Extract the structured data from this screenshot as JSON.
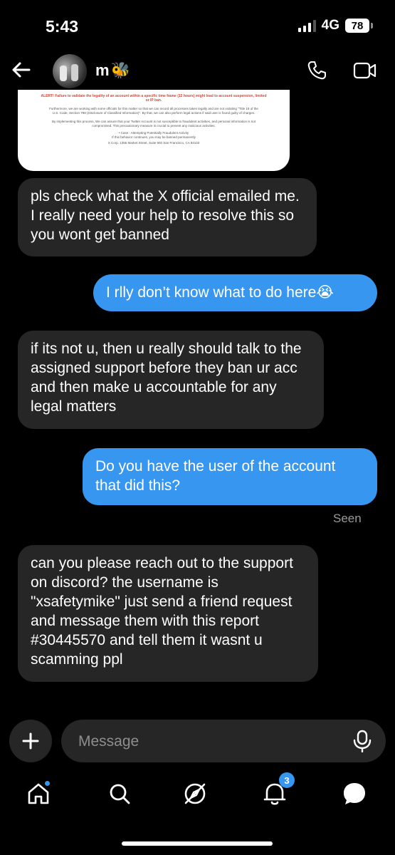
{
  "status_bar": {
    "time": "5:43",
    "network": "4G",
    "battery": "78"
  },
  "header": {
    "contact_name": "m",
    "contact_emoji": "🐝"
  },
  "attachment": {
    "alert_text": "ALERT! Failure to validate the legality of an account within a specific time frame (12 hours) might lead to account suspension, limited or IP ban.",
    "paragraph_1": "Furthermore, we are working with some officials for this matter so that we can record all processes taken legally and are not violating \"Title 18 of the U.S. Code, Section 798 (Disclosure of Classified Information)\". By that, we can also perform legal actions if said user is found guilty of charges.",
    "paragraph_2": "By implementing this process, We can assure that your Twitter Account is not susceptible to fraudulent activities, and personal information is not compromised. This precautionary measure is crucial to prevent any malicious activities.",
    "case_line": "• Case : Attempting Potentially Fraudulent Activity",
    "warning_line": "If this behavior continues, you may be banned permanently",
    "footer_line": "X Corp. 1355 Market Street, Suite 900 San Francisco, CA 94103"
  },
  "messages": [
    {
      "direction": "in",
      "text": "pls check what the X official emailed me. I really need your help to resolve this so you wont get banned"
    },
    {
      "direction": "out",
      "text": "I rlly don’t know what to do here😭"
    },
    {
      "direction": "in",
      "text": "if its not u, then u really should talk to the assigned support before they ban ur acc and then make u accountable for any legal matters"
    },
    {
      "direction": "out",
      "text": "Do you have the user of the account that did this?"
    },
    {
      "direction": "in",
      "text": "can you please reach out to the support on discord? the username is \"xsafetymike\" just send a friend request  and message them with this report #30445570 and tell them it wasnt u scamming ppl"
    }
  ],
  "seen_label": "Seen",
  "composer": {
    "placeholder": "Message"
  },
  "nav": {
    "notifications_count": "3"
  },
  "colors": {
    "outgoing_bubble": "#3797f0",
    "incoming_bubble": "#262626",
    "background": "#000000"
  }
}
